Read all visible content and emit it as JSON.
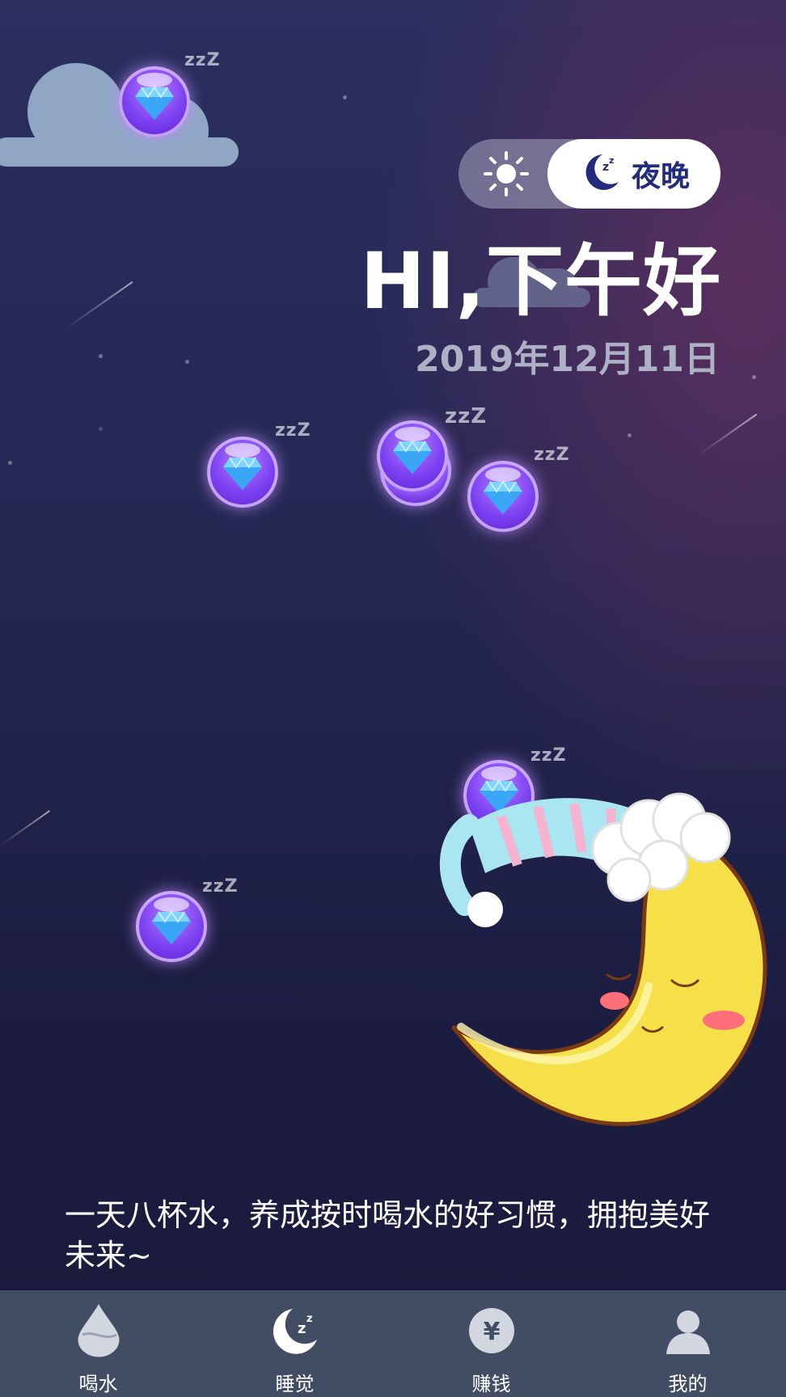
{
  "toggle": {
    "day_icon": "sun-icon",
    "night_icon": "moon-zzz-icon",
    "night_label": "夜晚"
  },
  "greeting": "HI,下午好",
  "date": "2019年12月11日",
  "gems": {
    "icon": "diamond-bubble-icon",
    "snore": "zzZ"
  },
  "motto": "一天八杯水，养成按时喝水的好习惯，拥抱美好未来~",
  "tabbar": {
    "items": [
      {
        "label": "喝水",
        "icon": "water-drop-icon"
      },
      {
        "label": "睡觉",
        "icon": "moon-icon"
      },
      {
        "label": "赚钱",
        "icon": "yen-coin-icon"
      },
      {
        "label": "我的",
        "icon": "user-icon"
      }
    ],
    "active_index": 1
  },
  "colors": {
    "background_top": "#2a2f5e",
    "background_bottom": "#1a1a3d",
    "tabbar": "#424c63",
    "gem": "#7a3ff0",
    "night_label": "#232b7b"
  }
}
